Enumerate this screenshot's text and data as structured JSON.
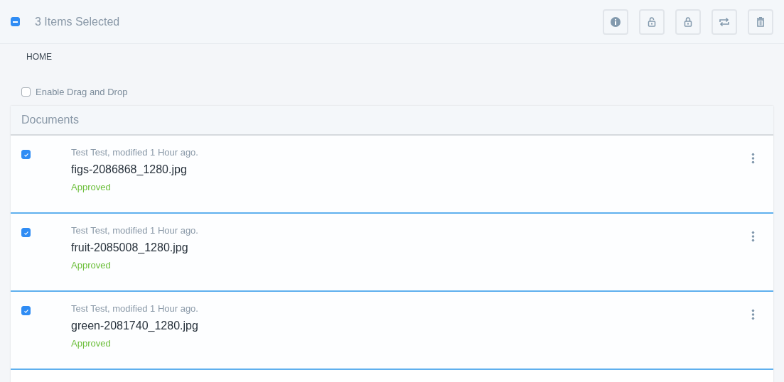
{
  "selection_bar": {
    "checkbox": {
      "indeterminate": true
    },
    "label": "3 Items Selected",
    "actions": [
      {
        "kind": "info"
      },
      {
        "kind": "unlock"
      },
      {
        "kind": "lock"
      },
      {
        "kind": "move"
      },
      {
        "kind": "delete"
      }
    ]
  },
  "breadcrumb": "HOME",
  "drag_drop": {
    "label": "Enable Drag and Drop",
    "checked": false
  },
  "panel": {
    "title": "Documents",
    "rows": [
      {
        "meta": "Test Test, modified 1 Hour ago.",
        "name": "figs-2086868_1280.jpg",
        "status": "Approved",
        "checked": true,
        "selected": true
      },
      {
        "meta": "Test Test, modified 1 Hour ago.",
        "name": "fruit-2085008_1280.jpg",
        "status": "Approved",
        "checked": true,
        "selected": true
      },
      {
        "meta": "Test Test, modified 1 Hour ago.",
        "name": "green-2081740_1280.jpg",
        "status": "Approved",
        "checked": true,
        "selected": true
      }
    ]
  }
}
